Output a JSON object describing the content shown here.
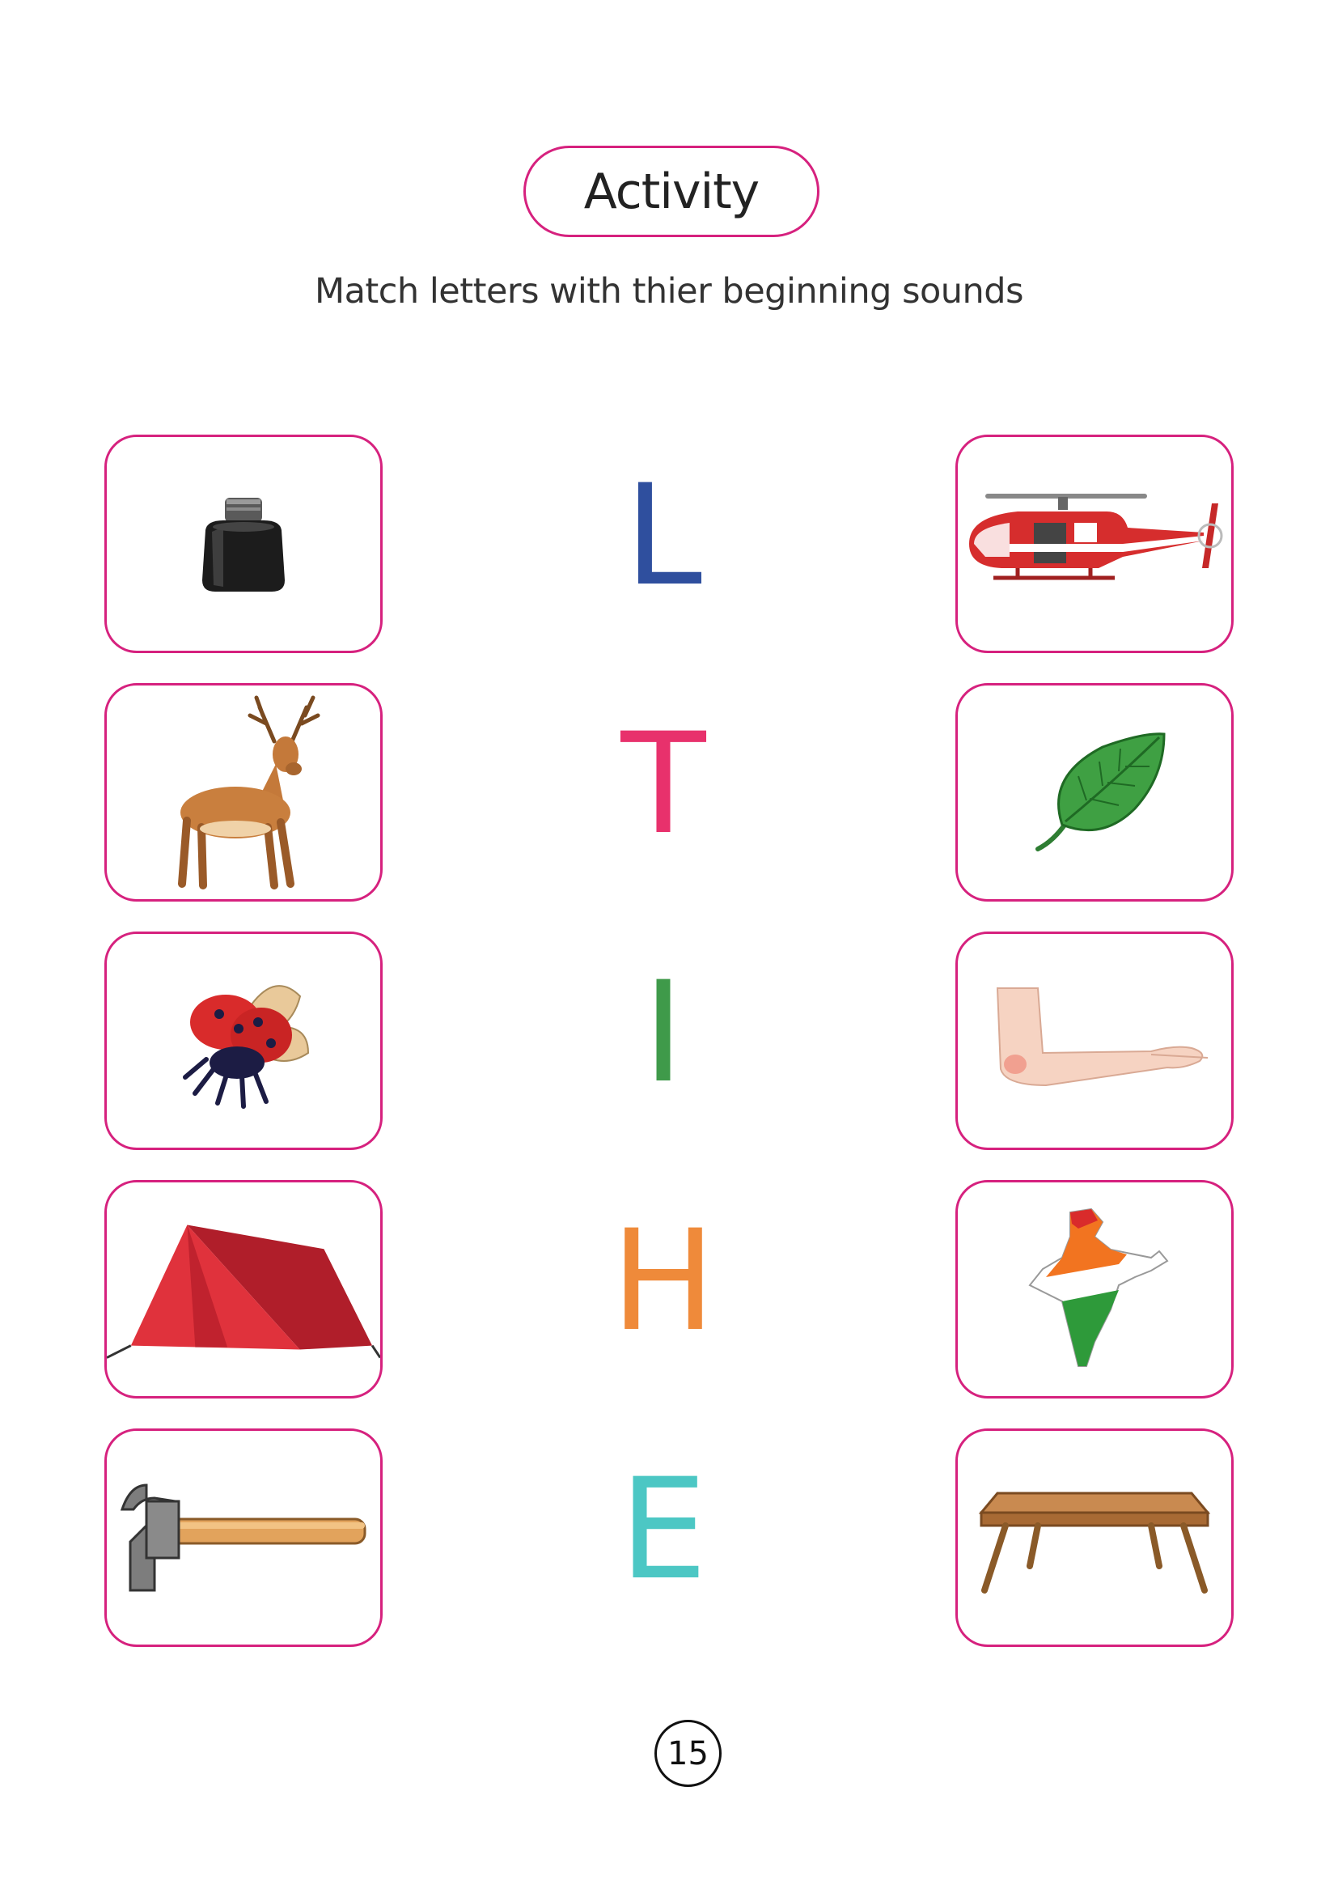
{
  "title": "Activity",
  "instructions": "Match letters with thier beginning sounds",
  "letters": [
    {
      "char": "L",
      "color": "#2f4f9e"
    },
    {
      "char": "T",
      "color": "#e8316c"
    },
    {
      "char": "I",
      "color": "#3f9a4a"
    },
    {
      "char": "H",
      "color": "#ef8a3a"
    },
    {
      "char": "E",
      "color": "#4cc7c4"
    }
  ],
  "left_pictures": [
    "ink-bottle-icon",
    "deer-icon",
    "insect-icon",
    "tent-icon",
    "hammer-icon"
  ],
  "right_pictures": [
    "helicopter-icon",
    "leaf-icon",
    "elbow-icon",
    "india-map-icon",
    "table-icon"
  ],
  "colors": {
    "card_border": "#d6217e",
    "title_border": "#d6217e"
  },
  "page_number": "15"
}
